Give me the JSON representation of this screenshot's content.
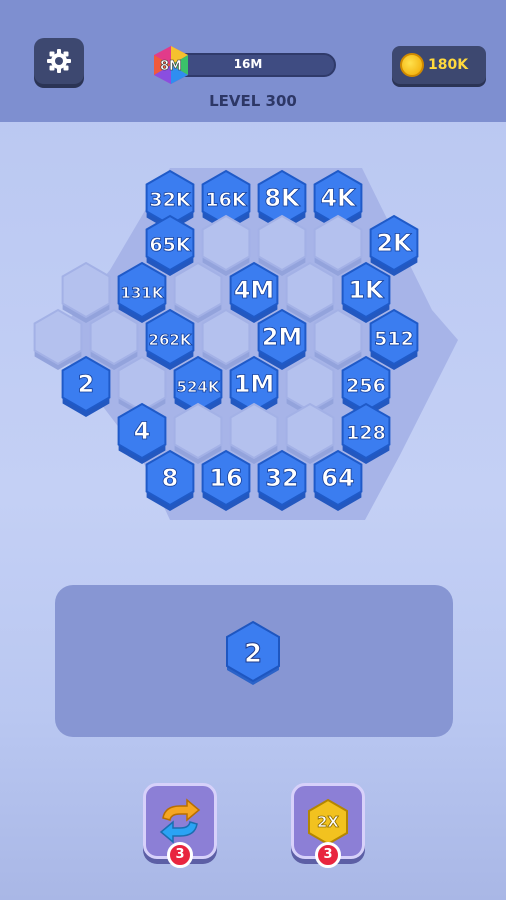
{
  "header": {
    "current_value": "8M",
    "target_value": "16M",
    "progress": 0.0,
    "level_label": "LEVEL 300",
    "coins": "180K"
  },
  "board": {
    "rows": [
      [
        null,
        "32K",
        "16K",
        "8K",
        "4K",
        null
      ],
      [
        null,
        "65K",
        "",
        "",
        "",
        "2K"
      ],
      [
        "",
        "131K",
        "",
        "4M",
        "",
        "1K"
      ],
      [
        "",
        "",
        "262K",
        "",
        "2M",
        "",
        "512"
      ],
      [
        "2",
        "",
        "524K",
        "1M",
        "",
        "256"
      ],
      [
        null,
        "4",
        "",
        "",
        "",
        "128"
      ],
      [
        null,
        null,
        "8",
        "16",
        "32",
        "64"
      ]
    ]
  },
  "next_tile": "2",
  "boosters": [
    {
      "name": "swap",
      "count": "3"
    },
    {
      "name": "double",
      "label": "2X",
      "count": "3"
    }
  ],
  "colors": {
    "tile_blue": "#3b7df0",
    "empty_cell": "#b4c1ee",
    "accent_dark": "#3d4870"
  }
}
